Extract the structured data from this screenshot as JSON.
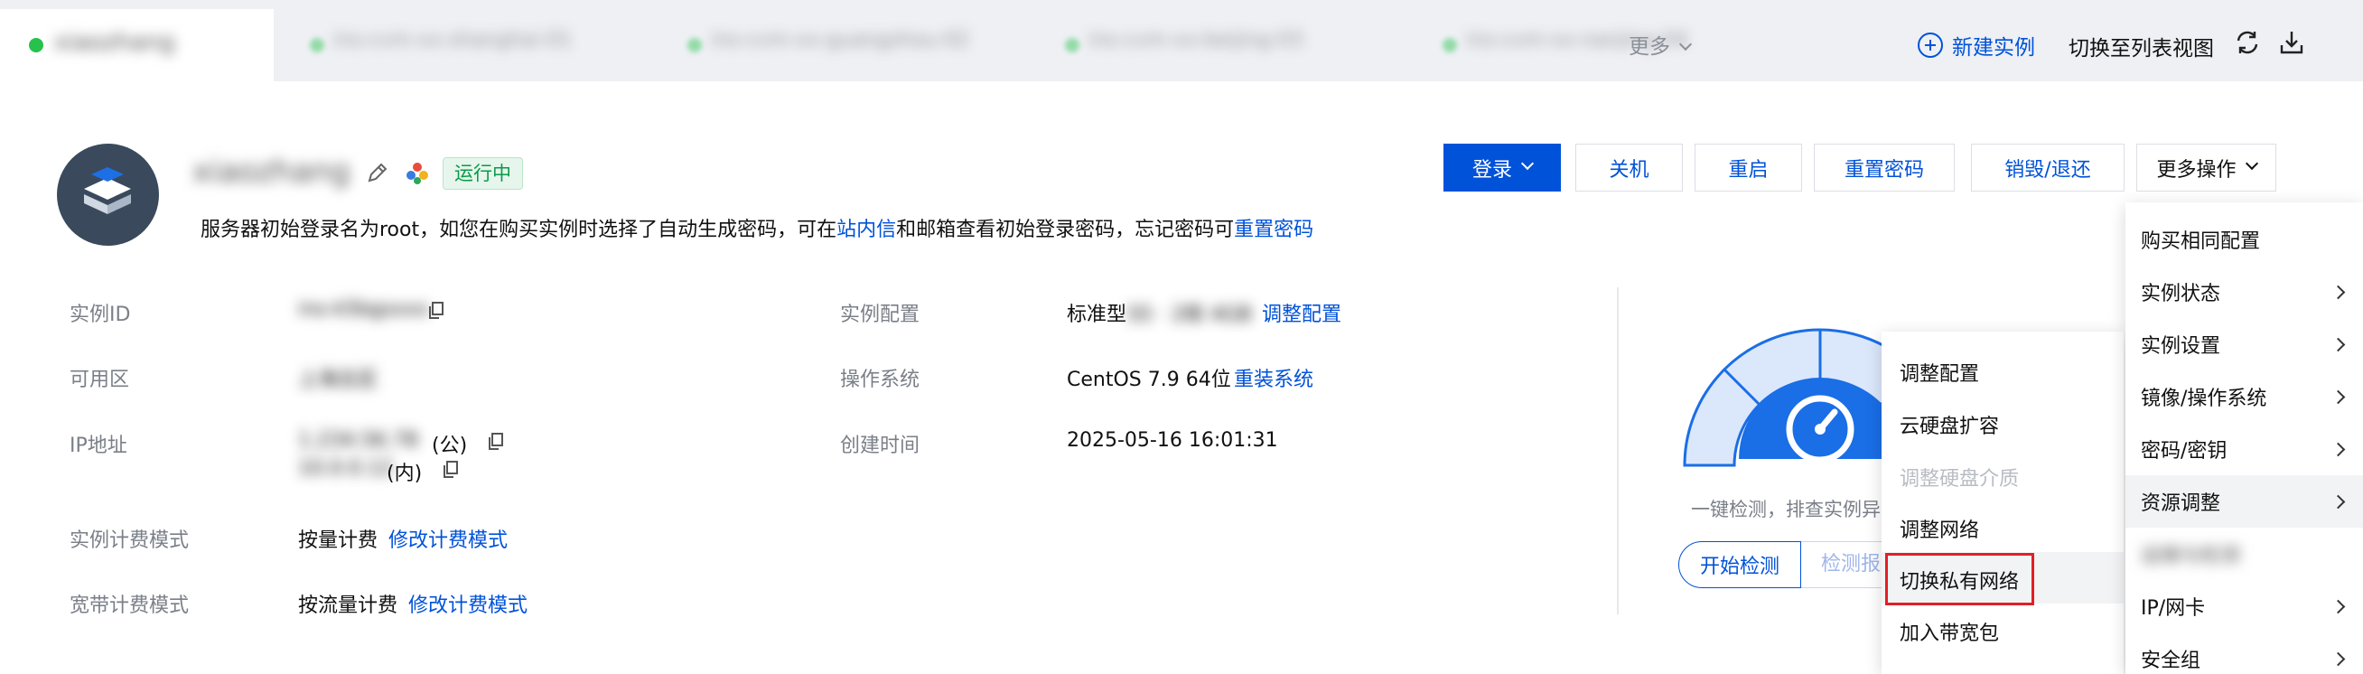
{
  "tabs": {
    "active_name": "xiaozhang",
    "other_names": [
      "ins-cvm-xx-shanghai-01",
      "ins-cvm-xx-guangzhou-02",
      "ins-cvm-xx-beijing-03",
      "ins-cvm-xx-nanjing-04"
    ],
    "more_label": "更多",
    "new_instance_label": "新建实例",
    "switch_list_label": "切换至列表视图"
  },
  "header": {
    "instance_name": "xiaozhang",
    "status": "运行中",
    "notice_part1": "服务器初始登录名为root，如您在购买实例时选择了自动生成密码，可在",
    "notice_link1": "站内信",
    "notice_part2": "和邮箱查看初始登录密码，忘记密码可",
    "notice_link2": "重置密码"
  },
  "actions": {
    "login": "登录",
    "shutdown": "关机",
    "reboot": "重启",
    "reset_password": "重置密码",
    "destroy": "销毁/退还",
    "more": "更多操作"
  },
  "info": {
    "instance_id_label": "实例ID",
    "instance_id_value": "ins-k5bgsxxx",
    "zone_label": "可用区",
    "zone_value": "上海五区",
    "ip_label": "IP地址",
    "ip_public_value": "1.234.56.78",
    "ip_public_suffix": "(公)",
    "ip_private_value": "10.0.0.12",
    "ip_private_suffix": "(内)",
    "billing_label": "实例计费模式",
    "billing_value": "按量计费",
    "billing_link": "修改计费模式",
    "bandwidth_label": "宽带计费模式",
    "bandwidth_value": "按流量计费",
    "bandwidth_link": "修改计费模式",
    "config_label": "实例配置",
    "config_value": "标准型",
    "config_blurred": "S5 · 2核 4GB",
    "config_link": "调整配置",
    "os_label": "操作系统",
    "os_value": "CentOS 7.9 64位",
    "os_link": "重装系统",
    "created_label": "创建时间",
    "created_value": "2025-05-16 16:01:31"
  },
  "health": {
    "text": "一键检测，排查实例异",
    "check_button": "开始检测",
    "report_button": "检测报告"
  },
  "submenu": {
    "items": [
      "调整配置",
      "云硬盘扩容",
      "调整硬盘介质",
      "调整网络",
      "切换私有网络",
      "加入带宽包"
    ]
  },
  "main_menu": {
    "items": [
      "购买相同配置",
      "实例状态",
      "实例设置",
      "镜像/操作系统",
      "密码/密钥",
      "资源调整",
      "IP/网卡",
      "安全组"
    ],
    "blurred_item": "运维与检测"
  },
  "colors": {
    "primary": "#0052d9",
    "status_green": "#0a9a48",
    "highlight_red": "#e21f26"
  }
}
